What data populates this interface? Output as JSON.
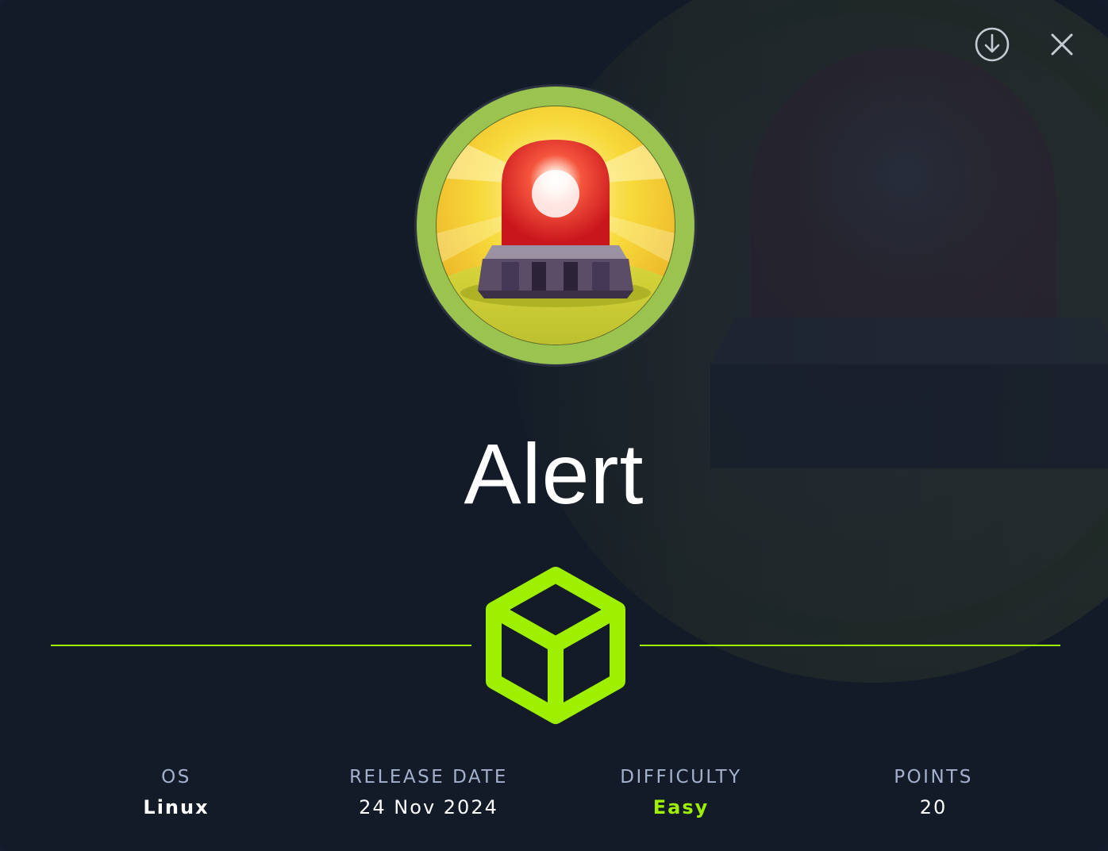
{
  "machine": {
    "name": "Alert"
  },
  "header": {
    "download_icon": "download-circle-icon",
    "close_icon": "close-icon"
  },
  "badge": {
    "icon": "siren-icon",
    "ring_color": "#9ac34f"
  },
  "divider": {
    "icon": "cube-icon",
    "color": "#9fef00"
  },
  "stats": [
    {
      "label": "OS",
      "value": "Linux"
    },
    {
      "label": "RELEASE DATE",
      "value": "24 Nov 2024"
    },
    {
      "label": "DIFFICULTY",
      "value": "Easy",
      "color": "#9fef00"
    },
    {
      "label": "POINTS",
      "value": "20"
    }
  ]
}
